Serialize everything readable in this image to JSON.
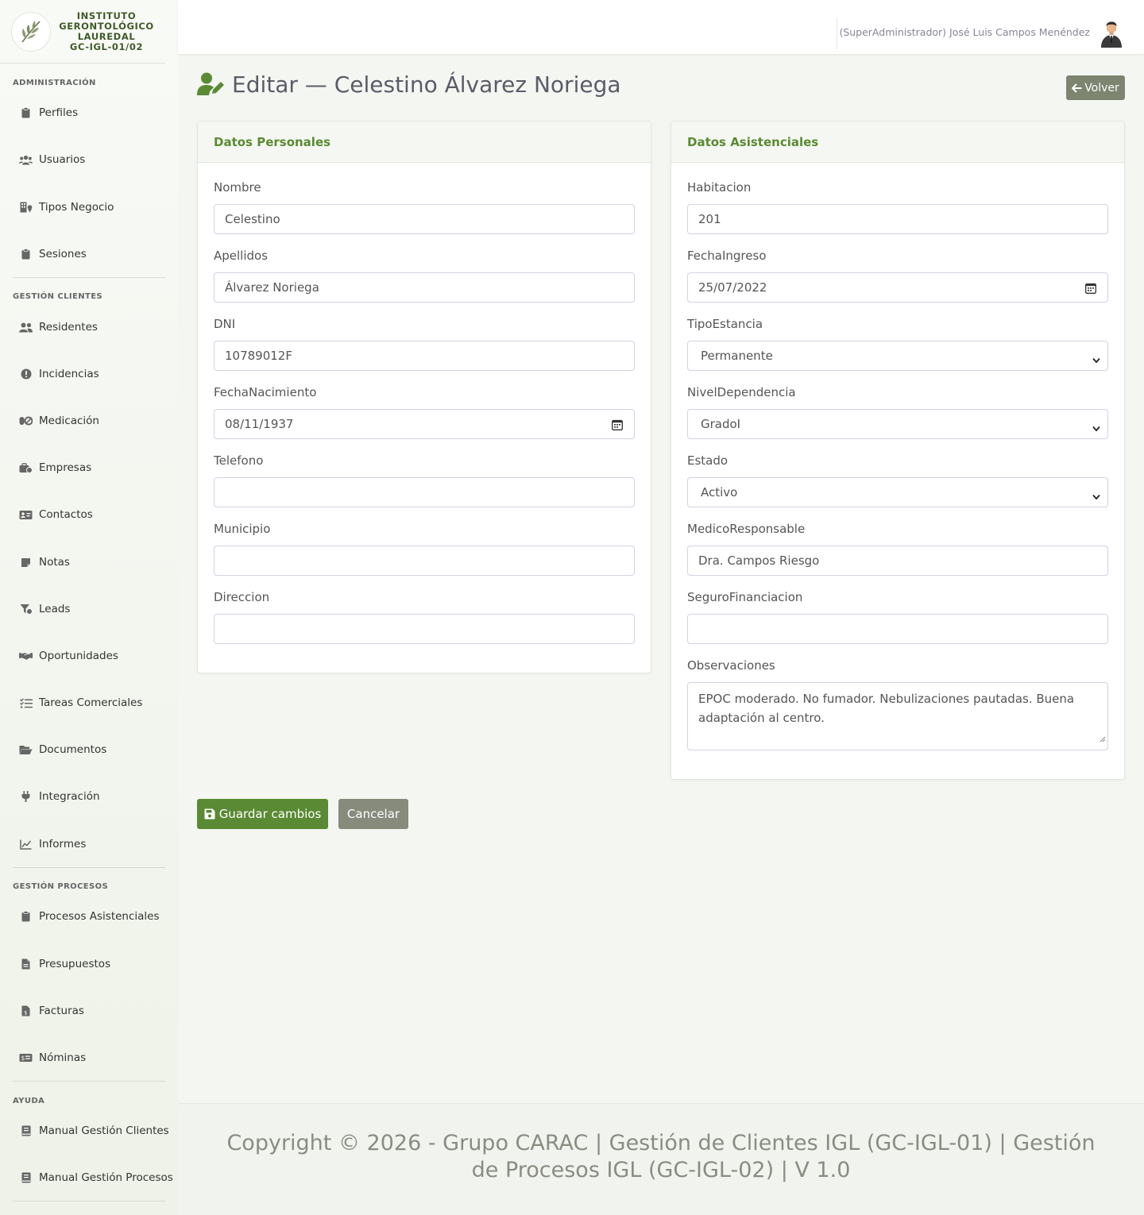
{
  "brand": {
    "lines": [
      "INSTITUTO",
      "GERONTOLÓGICO",
      "LAUREDAL",
      "GC-IGL-01/02"
    ]
  },
  "sidebar": {
    "groups": [
      {
        "title": "ADMINISTRACIÓN",
        "items": [
          {
            "label": "Perfiles",
            "icon": "clipboard-icon"
          },
          {
            "label": "Usuarios",
            "icon": "users-icon"
          },
          {
            "label": "Tipos Negocio",
            "icon": "building-icon"
          },
          {
            "label": "Sesiones",
            "icon": "clipboard-icon"
          }
        ]
      },
      {
        "title": "GESTIÓN CLIENTES",
        "items": [
          {
            "label": "Residentes",
            "icon": "user-group-icon"
          },
          {
            "label": "Incidencias",
            "icon": "alert-circle-icon"
          },
          {
            "label": "Medicación",
            "icon": "pills-icon"
          },
          {
            "label": "Empresas",
            "icon": "briefcase-icon"
          },
          {
            "label": "Contactos",
            "icon": "id-card-icon"
          },
          {
            "label": "Notas",
            "icon": "sticky-note-icon"
          },
          {
            "label": "Leads",
            "icon": "filter-icon"
          },
          {
            "label": "Oportunidades",
            "icon": "handshake-icon"
          },
          {
            "label": "Tareas Comerciales",
            "icon": "tasks-icon"
          },
          {
            "label": "Documentos",
            "icon": "folder-open-icon"
          },
          {
            "label": "Integración",
            "icon": "plug-icon"
          },
          {
            "label": "Informes",
            "icon": "chart-line-icon"
          }
        ]
      },
      {
        "title": "GESTIÓN PROCESOS",
        "items": [
          {
            "label": "Procesos Asistenciales",
            "icon": "clipboard-icon"
          },
          {
            "label": "Presupuestos",
            "icon": "file-icon"
          },
          {
            "label": "Facturas",
            "icon": "invoice-icon"
          },
          {
            "label": "Nóminas",
            "icon": "money-icon"
          }
        ]
      },
      {
        "title": "AYUDA",
        "items": [
          {
            "label": "Manual Gestión Clientes",
            "icon": "book-icon"
          },
          {
            "label": "Manual Gestión Procesos",
            "icon": "book-icon"
          }
        ]
      }
    ]
  },
  "topbar": {
    "user": "(SuperAdministrador) José Luis Campos Menéndez"
  },
  "header": {
    "title": "Editar — Celestino Álvarez Noriega",
    "back_label": "Volver"
  },
  "personal": {
    "title": "Datos Personales",
    "fields": [
      {
        "label": "Nombre",
        "value": ""
      },
      {
        "label": "Apellidos",
        "value": ""
      },
      {
        "label": "DNI",
        "value": ""
      },
      {
        "label": "FechaNacimiento",
        "value": ""
      },
      {
        "label": "Telefono",
        "value": ""
      },
      {
        "label": "Municipio",
        "value": ""
      },
      {
        "label": "Direccion",
        "value": ""
      }
    ],
    "values": {
      "nombre": "Celestino",
      "apellidos": "Álvarez Noriega",
      "dni": "10789012F",
      "fecha_nacimiento": "08/11/1937",
      "telefono": "",
      "municipio": "",
      "direccion": ""
    }
  },
  "asistencial": {
    "title": "Datos Asistenciales",
    "labels": {
      "habitacion": "Habitacion",
      "fecha_ingreso": "FechaIngreso",
      "tipo_estancia": "TipoEstancia",
      "nivel_dependencia": "NivelDependencia",
      "estado": "Estado",
      "medico": "MedicoResponsable",
      "seguro": "SeguroFinanciacion",
      "observaciones": "Observaciones"
    },
    "values": {
      "habitacion": "201",
      "fecha_ingreso": "25/07/2022",
      "tipo_estancia": "Permanente",
      "nivel_dependencia": "GradoI",
      "estado": "Activo",
      "medico": "Dra. Campos Riesgo",
      "seguro": "",
      "observaciones": "EPOC moderado. No fumador. Nebulizaciones pautadas. Buena adaptación al centro."
    }
  },
  "actions": {
    "save_label": "Guardar cambios",
    "cancel_label": "Cancelar"
  },
  "footer": {
    "text": "Copyright © 2026 - Grupo CARAC | Gestión de Clientes IGL (GC-IGL-01) | Gestión de Procesos IGL (GC-IGL-02) | V 1.0"
  },
  "colors": {
    "accent": "#5a8a33",
    "secondary_button": "#878b7c",
    "back_button": "#7d8570"
  }
}
